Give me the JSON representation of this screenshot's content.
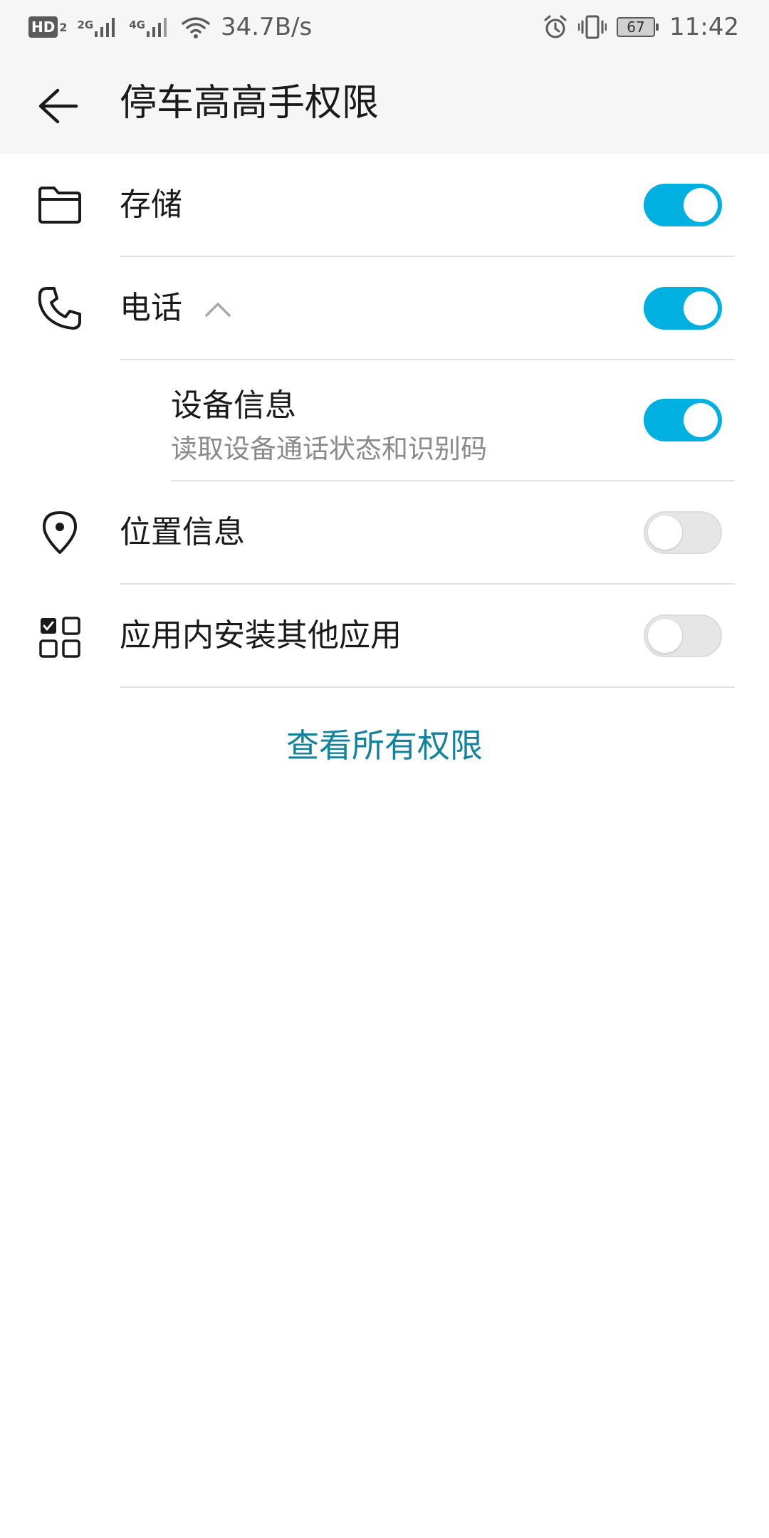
{
  "status_bar": {
    "hd_label": "HD",
    "hd_sub": "2",
    "signal_1_label": "2G",
    "signal_2_label": "4G",
    "net_speed": "34.7B/s",
    "battery": "67",
    "time": "11:42"
  },
  "header": {
    "title": "停车高高手权限"
  },
  "permissions": [
    {
      "label": "存储",
      "icon": "folder-icon",
      "enabled": true
    },
    {
      "label": "电话",
      "icon": "phone-icon",
      "enabled": true,
      "expanded": true,
      "sub_items": [
        {
          "title": "设备信息",
          "description": "读取设备通话状态和识别码",
          "enabled": true
        }
      ]
    },
    {
      "label": "位置信息",
      "icon": "location-icon",
      "enabled": false
    },
    {
      "label": "应用内安装其他应用",
      "icon": "apps-grid-icon",
      "enabled": false
    }
  ],
  "view_all_label": "查看所有权限",
  "colors": {
    "toggle_on": "#00b0e0",
    "toggle_off": "#e6e6e6",
    "link": "#13829c",
    "header_bg": "#f6f6f6"
  }
}
